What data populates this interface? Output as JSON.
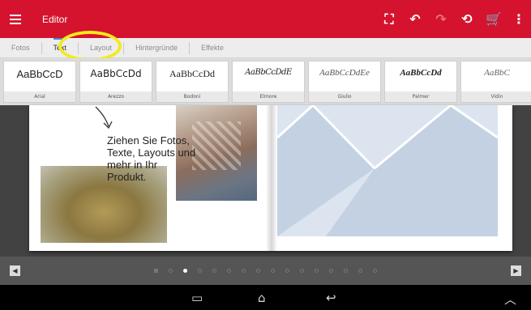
{
  "toolbar": {
    "title": "Editor",
    "icons": [
      "menu-icon",
      "fullscreen-icon",
      "undo-icon",
      "redo-icon",
      "refresh-icon",
      "cart-icon",
      "overflow-icon"
    ]
  },
  "tabs": [
    {
      "label": "Fotos",
      "active": false
    },
    {
      "label": "Text",
      "active": true
    },
    {
      "label": "Layout",
      "active": false
    },
    {
      "label": "Hintergründe",
      "active": false
    },
    {
      "label": "Effekte",
      "active": false
    }
  ],
  "fonts": [
    {
      "sample": "AaBbCcD",
      "name": "Arial"
    },
    {
      "sample": "AaBbCcDd",
      "name": "Arezzo"
    },
    {
      "sample": "AaBbCcDd",
      "name": "Bodoni"
    },
    {
      "sample": "AaBbCcDdE",
      "name": "Elmore"
    },
    {
      "sample": "AaBbCcDdEe",
      "name": "Giulio"
    },
    {
      "sample": "AaBbCcDd",
      "name": "Palmer"
    },
    {
      "sample": "AaBbC",
      "name": "Vidin"
    }
  ],
  "canvas": {
    "hint": "Ziehen Sie Fotos, Texte, Layouts und mehr in Ihr Produkt."
  },
  "colors": {
    "toolbar": "#d5132e",
    "highlight": "#f2ea1c",
    "placeholder": "#dbe4ef"
  }
}
